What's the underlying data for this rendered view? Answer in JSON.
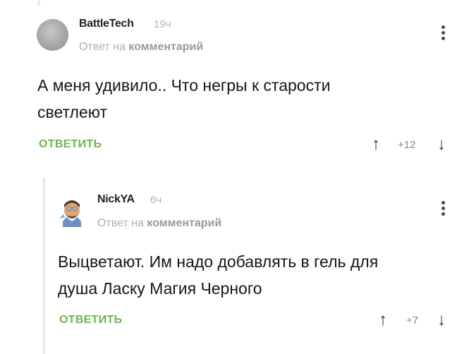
{
  "comment1": {
    "author": "BattleTech",
    "time": "19ч",
    "reply_prefix": "Ответ на",
    "reply_target": "комментарий",
    "text_line1": "А меня удивило.. Что негры к старости",
    "text_line2": "светлеют",
    "reply_button": "ОТВЕТИТЬ",
    "score": "+12",
    "up_icon": "arrow-up-icon",
    "down_icon": "arrow-down-icon",
    "menu_icon": "more-vertical-icon"
  },
  "comment2": {
    "author": "NickYA",
    "time": "6ч",
    "reply_prefix": "Ответ на",
    "reply_target": "комментарий",
    "text_line1": "Выцветают. Им надо добавлять в гель для",
    "text_line2": "душа Ласку Магия Черного",
    "reply_button": "ОТВЕТИТЬ",
    "score": "+7",
    "up_icon": "arrow-up-icon",
    "down_icon": "arrow-down-icon",
    "menu_icon": "more-vertical-icon"
  },
  "colors": {
    "accent_green": "#6fb54a",
    "meta_gray": "#b0b0b0"
  }
}
